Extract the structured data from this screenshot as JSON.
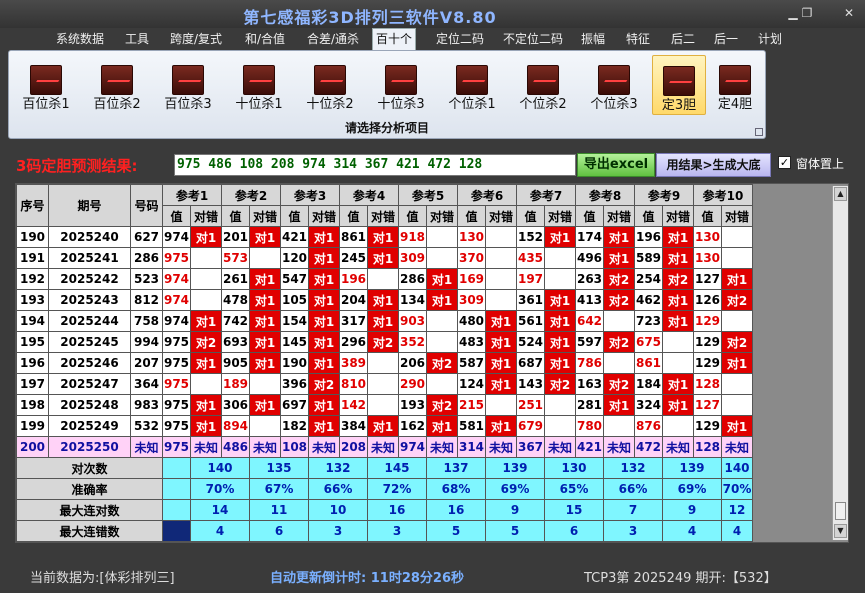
{
  "window": {
    "title": "第七感福彩3D排列三软件V8.80"
  },
  "menu": [
    "系统数据",
    "工具",
    "跨度/复式",
    "和/合值",
    "合差/通杀",
    "百十个",
    "定位二码",
    "不定位二码",
    "振幅",
    "特征",
    "后二",
    "后一",
    "计划"
  ],
  "ribbon": {
    "buttons": [
      "百位杀1",
      "百位杀2",
      "百位杀3",
      "十位杀1",
      "十位杀2",
      "十位杀3",
      "个位杀1",
      "个位杀2",
      "个位杀3",
      "定3胆",
      "定4胆"
    ],
    "footer": "请选择分析项目"
  },
  "prediction": {
    "label": "3码定胆预测结果:",
    "value": "975 486 108 208 974 314 367 421 472 128",
    "excel_btn": "导出excel",
    "gen_btn": "用结果>生成大底",
    "pin_label": "窗体置上",
    "pin_checked": "✓"
  },
  "grid": {
    "headers": {
      "seq": "序号",
      "period": "期号",
      "code": "号码",
      "refs": [
        "参考1",
        "参考2",
        "参考3",
        "参考4",
        "参考5",
        "参考6",
        "参考7",
        "参考8",
        "参考9",
        "参考10"
      ],
      "val": "值",
      "cor": "对错"
    },
    "rows": [
      {
        "seq": "190",
        "period": "2025240",
        "code": "627",
        "cells": [
          [
            "974",
            "对1"
          ],
          [
            "201",
            "对1"
          ],
          [
            "421",
            "对1"
          ],
          [
            "861",
            "对1"
          ],
          [
            "918",
            ""
          ],
          [
            "130",
            ""
          ],
          [
            "152",
            "对1"
          ],
          [
            "174",
            "对1"
          ],
          [
            "196",
            "对1"
          ],
          [
            "130",
            ""
          ]
        ]
      },
      {
        "seq": "191",
        "period": "2025241",
        "code": "286",
        "cells": [
          [
            "975",
            ""
          ],
          [
            "573",
            ""
          ],
          [
            "120",
            "对1"
          ],
          [
            "245",
            "对1"
          ],
          [
            "309",
            ""
          ],
          [
            "370",
            ""
          ],
          [
            "435",
            ""
          ],
          [
            "496",
            "对1"
          ],
          [
            "589",
            "对1"
          ],
          [
            "130",
            ""
          ]
        ]
      },
      {
        "seq": "192",
        "period": "2025242",
        "code": "523",
        "cells": [
          [
            "974",
            ""
          ],
          [
            "261",
            "对1"
          ],
          [
            "547",
            "对1"
          ],
          [
            "196",
            ""
          ],
          [
            "286",
            "对1"
          ],
          [
            "169",
            ""
          ],
          [
            "197",
            ""
          ],
          [
            "263",
            "对2"
          ],
          [
            "254",
            "对2"
          ],
          [
            "127",
            "对1"
          ]
        ]
      },
      {
        "seq": "193",
        "period": "2025243",
        "code": "812",
        "cells": [
          [
            "974",
            ""
          ],
          [
            "478",
            "对1"
          ],
          [
            "105",
            "对1"
          ],
          [
            "204",
            "对1"
          ],
          [
            "134",
            "对1"
          ],
          [
            "309",
            ""
          ],
          [
            "361",
            "对1"
          ],
          [
            "413",
            "对2"
          ],
          [
            "462",
            "对1"
          ],
          [
            "126",
            "对2"
          ]
        ]
      },
      {
        "seq": "194",
        "period": "2025244",
        "code": "758",
        "cells": [
          [
            "974",
            "对1"
          ],
          [
            "742",
            "对1"
          ],
          [
            "154",
            "对1"
          ],
          [
            "317",
            "对1"
          ],
          [
            "903",
            ""
          ],
          [
            "480",
            "对1"
          ],
          [
            "561",
            "对1"
          ],
          [
            "642",
            ""
          ],
          [
            "723",
            "对1"
          ],
          [
            "129",
            ""
          ]
        ]
      },
      {
        "seq": "195",
        "period": "2025245",
        "code": "994",
        "cells": [
          [
            "975",
            "对2"
          ],
          [
            "693",
            "对1"
          ],
          [
            "145",
            "对1"
          ],
          [
            "296",
            "对2"
          ],
          [
            "352",
            ""
          ],
          [
            "483",
            "对1"
          ],
          [
            "524",
            "对1"
          ],
          [
            "597",
            "对2"
          ],
          [
            "675",
            ""
          ],
          [
            "129",
            "对2"
          ]
        ]
      },
      {
        "seq": "196",
        "period": "2025246",
        "code": "207",
        "cells": [
          [
            "975",
            "对1"
          ],
          [
            "905",
            "对1"
          ],
          [
            "190",
            "对1"
          ],
          [
            "389",
            ""
          ],
          [
            "206",
            "对2"
          ],
          [
            "587",
            "对1"
          ],
          [
            "687",
            "对1"
          ],
          [
            "786",
            ""
          ],
          [
            "861",
            ""
          ],
          [
            "129",
            "对1"
          ]
        ]
      },
      {
        "seq": "197",
        "period": "2025247",
        "code": "364",
        "cells": [
          [
            "975",
            ""
          ],
          [
            "189",
            ""
          ],
          [
            "396",
            "对2"
          ],
          [
            "810",
            ""
          ],
          [
            "290",
            ""
          ],
          [
            "124",
            "对1"
          ],
          [
            "143",
            "对2"
          ],
          [
            "163",
            "对2"
          ],
          [
            "184",
            "对1"
          ],
          [
            "128",
            ""
          ]
        ]
      },
      {
        "seq": "198",
        "period": "2025248",
        "code": "983",
        "cells": [
          [
            "975",
            "对1"
          ],
          [
            "306",
            "对1"
          ],
          [
            "697",
            "对1"
          ],
          [
            "142",
            ""
          ],
          [
            "193",
            "对2"
          ],
          [
            "215",
            ""
          ],
          [
            "251",
            ""
          ],
          [
            "281",
            "对1"
          ],
          [
            "324",
            "对1"
          ],
          [
            "127",
            ""
          ]
        ]
      },
      {
        "seq": "199",
        "period": "2025249",
        "code": "532",
        "cells": [
          [
            "975",
            "对1"
          ],
          [
            "894",
            ""
          ],
          [
            "182",
            "对1"
          ],
          [
            "384",
            "对1"
          ],
          [
            "162",
            "对1"
          ],
          [
            "581",
            "对1"
          ],
          [
            "679",
            ""
          ],
          [
            "780",
            ""
          ],
          [
            "876",
            ""
          ],
          [
            "129",
            "对1"
          ]
        ]
      }
    ],
    "pending": {
      "seq": "200",
      "period": "2025250",
      "code": "未知",
      "cells": [
        [
          "975",
          "未知"
        ],
        [
          "486",
          "未知"
        ],
        [
          "108",
          "未知"
        ],
        [
          "208",
          "未知"
        ],
        [
          "974",
          "未知"
        ],
        [
          "314",
          "未知"
        ],
        [
          "367",
          "未知"
        ],
        [
          "421",
          "未知"
        ],
        [
          "472",
          "未知"
        ],
        [
          "128",
          "未知"
        ]
      ]
    },
    "stats": [
      {
        "label": "对次数",
        "values": [
          "140",
          "135",
          "132",
          "145",
          "137",
          "139",
          "130",
          "132",
          "139",
          "140"
        ]
      },
      {
        "label": "准确率",
        "values": [
          "70%",
          "67%",
          "66%",
          "72%",
          "68%",
          "69%",
          "65%",
          "66%",
          "69%",
          "70%"
        ]
      },
      {
        "label": "最大连对数",
        "values": [
          "14",
          "11",
          "10",
          "16",
          "16",
          "9",
          "15",
          "7",
          "9",
          "12"
        ]
      },
      {
        "label": "最大连错数",
        "values": [
          "4",
          "6",
          "3",
          "3",
          "5",
          "5",
          "6",
          "3",
          "4",
          "4"
        ]
      }
    ]
  },
  "status": {
    "source": "当前数据为:[体彩排列三]",
    "countdown": "自动更新倒计时: 11时28分26秒",
    "latest": "TCP3第 2025249 期开:【532】"
  },
  "colors": {
    "hit": "#e00000",
    "stats": "#7ff6ff",
    "pending": "#ffd2f7",
    "title": "#8fb6ff"
  }
}
